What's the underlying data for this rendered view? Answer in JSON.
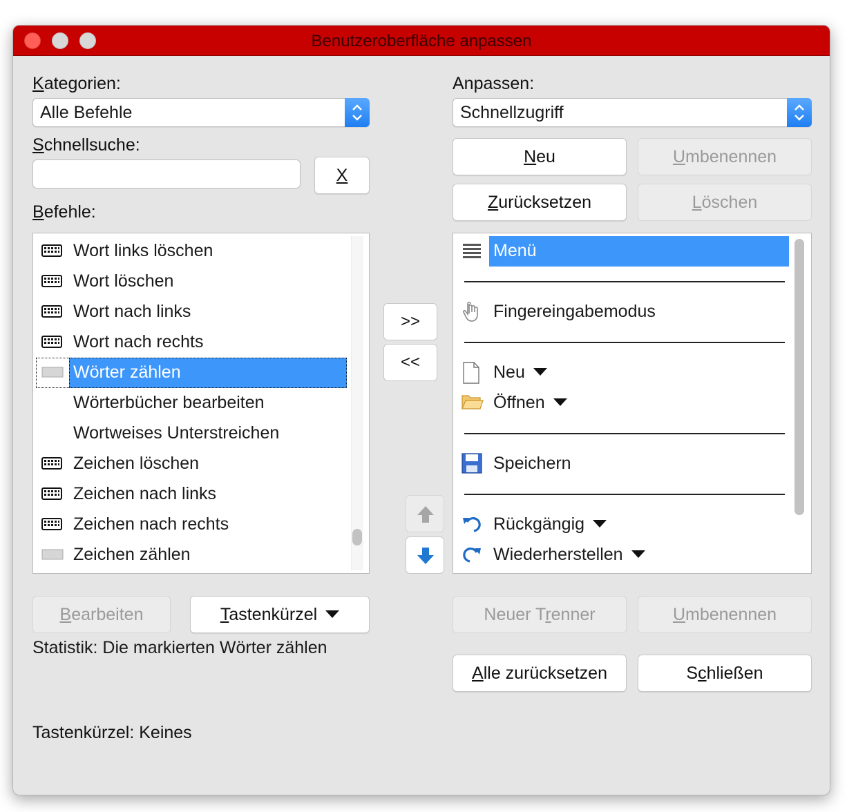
{
  "window": {
    "title": "Benutzeroberfläche anpassen"
  },
  "left": {
    "categories_label": "Kategorien:",
    "categories_value": "Alle Befehle",
    "quicksearch_label": "Schnellsuche:",
    "quicksearch_value": "",
    "clear_button": "X",
    "commands_label": "Befehle:",
    "commands": [
      {
        "label": "Wort links löschen",
        "icon": "keyboard-icon"
      },
      {
        "label": "Wort löschen",
        "icon": "keyboard-icon"
      },
      {
        "label": "Wort nach links",
        "icon": "keyboard-icon"
      },
      {
        "label": "Wort nach rechts",
        "icon": "keyboard-icon"
      },
      {
        "label": "Wörter zählen",
        "icon": "blank-icon",
        "selected": true
      },
      {
        "label": "Wörterbücher bearbeiten",
        "icon": ""
      },
      {
        "label": "Wortweises Unterstreichen",
        "icon": ""
      },
      {
        "label": "Zeichen löschen",
        "icon": "keyboard-icon"
      },
      {
        "label": "Zeichen nach links",
        "icon": "keyboard-icon"
      },
      {
        "label": "Zeichen nach rechts",
        "icon": "keyboard-icon"
      },
      {
        "label": "Zeichen zählen",
        "icon": "blank-icon"
      }
    ],
    "edit_button": "Bearbeiten",
    "shortcut_button": "Tastenkürzel",
    "statistics_text": "Statistik: Die markierten Wörter zählen",
    "shortcut_text": "Tastenkürzel: Keines"
  },
  "middle": {
    "add_button": ">>",
    "remove_button": "<<"
  },
  "right": {
    "customize_label": "Anpassen:",
    "customize_value": "Schnellzugriff",
    "new_button": "Neu",
    "rename_button": "Umbenennen",
    "reset_button": "Zurücksetzen",
    "delete_button": "Löschen",
    "items": [
      {
        "label": "Menü",
        "icon": "menu-icon",
        "selected": true
      },
      {
        "label": "Fingereingabemodus",
        "icon": "hand-icon"
      },
      {
        "label": "Neu",
        "icon": "document-icon",
        "dropdown": true
      },
      {
        "label": "Öffnen",
        "icon": "folder-icon",
        "dropdown": true
      },
      {
        "label": "Speichern",
        "icon": "save-icon"
      },
      {
        "label": "Rückgängig",
        "icon": "undo-icon",
        "dropdown": true
      },
      {
        "label": "Wiederherstellen",
        "icon": "redo-icon",
        "dropdown": true
      }
    ],
    "new_separator_button": "Neuer Trenner",
    "rename2_button": "Umbenennen",
    "reset_all_button": "Alle zurücksetzen",
    "close_button": "Schließen"
  }
}
